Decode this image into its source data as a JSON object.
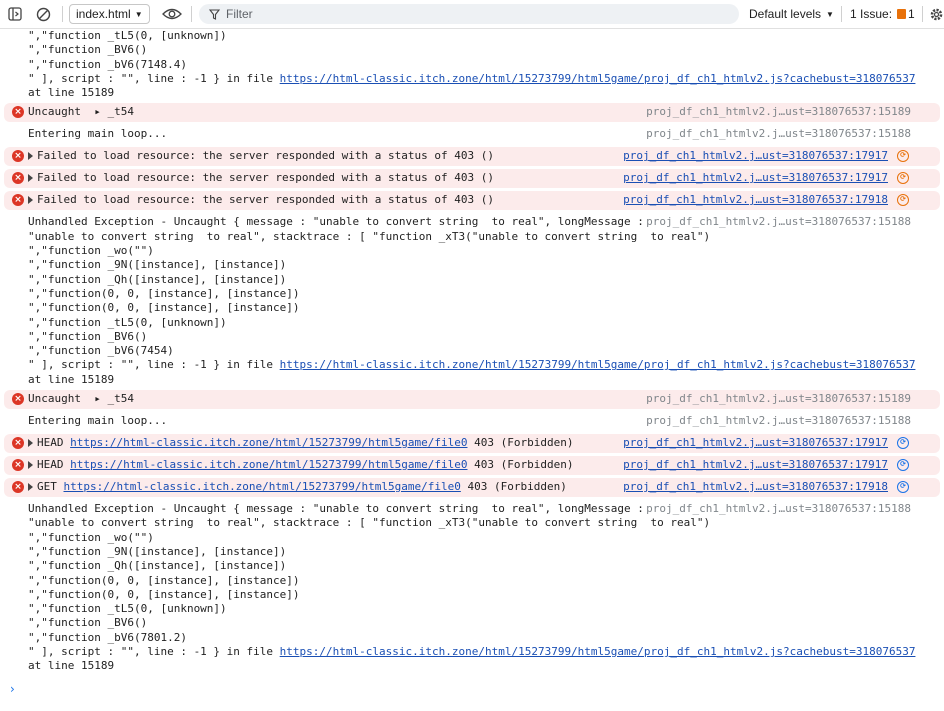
{
  "toolbar": {
    "context": "index.html",
    "filter_placeholder": "Filter",
    "levels": "Default levels",
    "issues_label": "1 Issue:",
    "issues_count": "1"
  },
  "log": [
    {
      "kind": "plain",
      "lines": [
        "\",\"function _tL5(0, [unknown])",
        "\",\"function _BV6()",
        "\",\"function _bV6(7148.4)"
      ]
    },
    {
      "kind": "linkline",
      "pre": "\" ], script : \"\", line : -1 } in file ",
      "link": "https://html-classic.itch.zone/html/15273799/html5game/proj_df_ch1_htmlv2.js?cachebust=318076537"
    },
    {
      "kind": "plain",
      "lines": [
        "at line 15189"
      ]
    },
    {
      "kind": "err",
      "text": "Uncaught  ▸ _t54",
      "source": "proj_df_ch1_htmlv2.j…ust=318076537:15189"
    },
    {
      "kind": "info",
      "text": "Entering main loop...",
      "source": "proj_df_ch1_htmlv2.j…ust=318076537:15188"
    },
    {
      "kind": "err403",
      "text": "Failed to load resource: the server responded with a status of 403 ()",
      "source": "proj_df_ch1_htmlv2.j…ust=318076537:17917"
    },
    {
      "kind": "err403",
      "text": "Failed to load resource: the server responded with a status of 403 ()",
      "source": "proj_df_ch1_htmlv2.j…ust=318076537:17917"
    },
    {
      "kind": "err403",
      "text": "Failed to load resource: the server responded with a status of 403 ()",
      "source": "proj_df_ch1_htmlv2.j…ust=318076537:17918"
    },
    {
      "kind": "exception",
      "first": "Unhandled Exception - Uncaught { message : \"unable to convert string  to real\", longMessage :",
      "source": "proj_df_ch1_htmlv2.j…ust=318076537:15188",
      "lines": [
        "\"unable to convert string  to real\", stacktrace : [ \"function _xT3(\"unable to convert string  to real\")",
        "\",\"function _wo(\"\")",
        "\",\"function _9N([instance], [instance])",
        "\",\"function _Qh([instance], [instance])",
        "\",\"function(0, 0, [instance], [instance])",
        "\",\"function(0, 0, [instance], [instance])",
        "\",\"function _tL5(0, [unknown])",
        "\",\"function _BV6()",
        "\",\"function _bV6(7454)"
      ]
    },
    {
      "kind": "linkline",
      "pre": "\" ], script : \"\", line : -1 } in file ",
      "link": "https://html-classic.itch.zone/html/15273799/html5game/proj_df_ch1_htmlv2.js?cachebust=318076537"
    },
    {
      "kind": "plain",
      "lines": [
        "at line 15189"
      ]
    },
    {
      "kind": "err",
      "text": "Uncaught  ▸ _t54",
      "source": "proj_df_ch1_htmlv2.j…ust=318076537:15189"
    },
    {
      "kind": "info",
      "text": "Entering main loop...",
      "source": "proj_df_ch1_htmlv2.j…ust=318076537:15188"
    },
    {
      "kind": "errnet",
      "method": "HEAD",
      "url": "https://html-classic.itch.zone/html/15273799/html5game/file0",
      "status": "403 (Forbidden)",
      "source": "proj_df_ch1_htmlv2.j…ust=318076537:17917"
    },
    {
      "kind": "errnet",
      "method": "HEAD",
      "url": "https://html-classic.itch.zone/html/15273799/html5game/file0",
      "status": "403 (Forbidden)",
      "source": "proj_df_ch1_htmlv2.j…ust=318076537:17917"
    },
    {
      "kind": "errnet",
      "method": "GET",
      "url": "https://html-classic.itch.zone/html/15273799/html5game/file0",
      "status": "403 (Forbidden)",
      "source": "proj_df_ch1_htmlv2.j…ust=318076537:17918"
    },
    {
      "kind": "exception",
      "first": "Unhandled Exception - Uncaught { message : \"unable to convert string  to real\", longMessage :",
      "source": "proj_df_ch1_htmlv2.j…ust=318076537:15188",
      "lines": [
        "\"unable to convert string  to real\", stacktrace : [ \"function _xT3(\"unable to convert string  to real\")",
        "\",\"function _wo(\"\")",
        "\",\"function _9N([instance], [instance])",
        "\",\"function _Qh([instance], [instance])",
        "\",\"function(0, 0, [instance], [instance])",
        "\",\"function(0, 0, [instance], [instance])",
        "\",\"function _tL5(0, [unknown])",
        "\",\"function _BV6()",
        "\",\"function _bV6(7801.2)"
      ]
    },
    {
      "kind": "linkline",
      "pre": "\" ], script : \"\", line : -1 } in file ",
      "link": "https://html-classic.itch.zone/html/15273799/html5game/proj_df_ch1_htmlv2.js?cachebust=318076537"
    },
    {
      "kind": "plain",
      "lines": [
        "at line 15189"
      ]
    }
  ]
}
